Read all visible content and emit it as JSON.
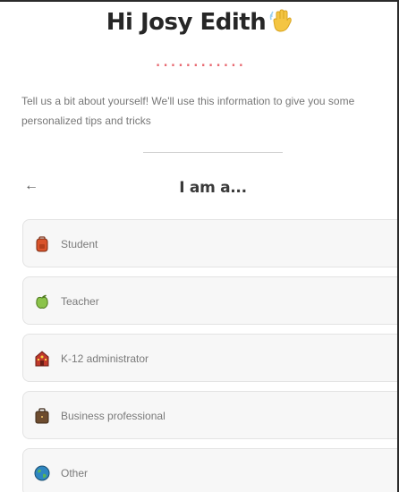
{
  "header": {
    "greeting": "Hi Josy Edith",
    "wave_icon": "waving-hand-icon",
    "dots": "............"
  },
  "intro": {
    "text": "Tell us a bit about yourself! We'll use this information to give you some personalized tips and tricks"
  },
  "question": {
    "back_icon": "←",
    "title": "I am a..."
  },
  "options": [
    {
      "label": "Student",
      "icon": "backpack-icon",
      "color": "#d9532b"
    },
    {
      "label": "Teacher",
      "icon": "apple-icon",
      "color": "#8bc34a"
    },
    {
      "label": "K-12 administrator",
      "icon": "school-building-icon",
      "color": "#c0392b"
    },
    {
      "label": "Business professional",
      "icon": "briefcase-icon",
      "color": "#6d4c2f"
    },
    {
      "label": "Other",
      "icon": "globe-icon",
      "color": "#2e86c1"
    }
  ]
}
